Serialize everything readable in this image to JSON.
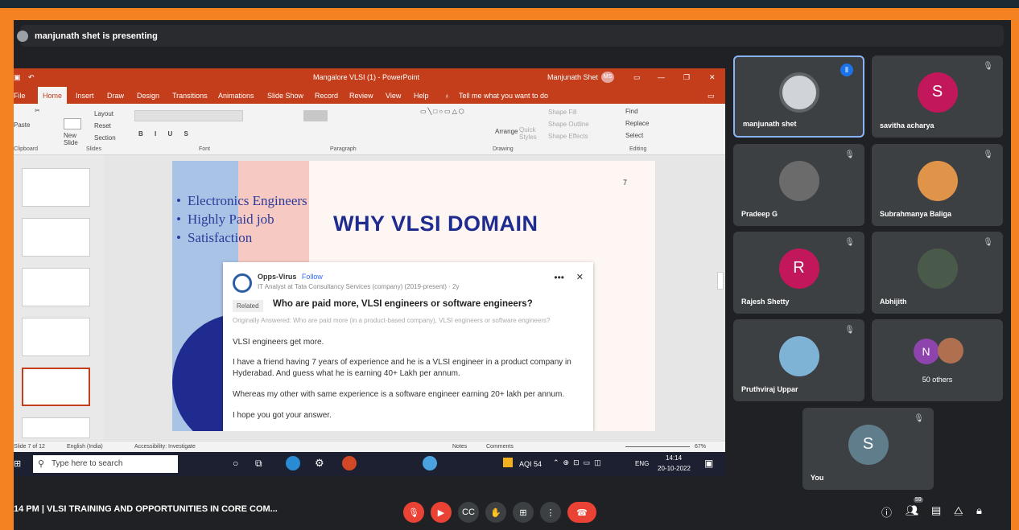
{
  "presenter": "manjunath shet is presenting",
  "ppt": {
    "title": "Mangalore VLSI (1) - PowerPoint",
    "user": "Manjunath Shet",
    "user_initials": "MS",
    "tabs": [
      "File",
      "Home",
      "Insert",
      "Draw",
      "Design",
      "Transitions",
      "Animations",
      "Slide Show",
      "Record",
      "Review",
      "View",
      "Help"
    ],
    "tell_me": "Tell me what you want to do",
    "ribbon": {
      "layout": "Layout",
      "reset": "Reset",
      "section": "Section",
      "new_slide": "New Slide",
      "arrange": "Arrange",
      "quick_styles": "Quick Styles",
      "shape_fill": "Shape Fill",
      "shape_outline": "Shape Outline",
      "shape_effects": "Shape Effects",
      "find": "Find",
      "replace": "Replace",
      "select": "Select",
      "groups": [
        "Clipboard",
        "Slides",
        "Font",
        "Paragraph",
        "Drawing",
        "Editing"
      ],
      "paste": "Paste"
    },
    "slide": {
      "bullets": [
        "Electronics Engineers",
        "Highly Paid job",
        "Satisfaction"
      ],
      "title": "WHY VLSI DOMAIN",
      "number": "7"
    },
    "quora": {
      "user": "Opps-Virus",
      "follow": "Follow",
      "sub": "IT Analyst at Tata Consultancy Services (company) (2019-present) · 2y",
      "related": "Related",
      "question": "Who are paid more, VLSI engineers or software engineers?",
      "orig": "Originally Answered: Who are paid more (in a product-based company), VLSI engineers or software engineers?",
      "p1": "VLSI engineers get more.",
      "p2": "I have a friend having 7 years of experience and he is a VLSI engineer in a product company in Hyderabad. And guess what he is earning 40+ Lakh per annum.",
      "p3": "Whereas my other with same experience is a software engineer earning 20+ lakh per annum.",
      "p4": "I hope you got your answer."
    },
    "status": {
      "slide": "Slide 7 of 12",
      "lang": "English (India)",
      "access": "Accessibility: Investigate",
      "notes": "Notes",
      "comments": "Comments",
      "zoom": "67%"
    },
    "taskbar": {
      "search": "Type here to search",
      "aqi": "AQI 54",
      "lang": "ENG",
      "time": "14:14",
      "date": "20-10-2022"
    }
  },
  "participants": [
    {
      "name": "manjunath shet",
      "initial": "",
      "color": "#d0d4d8"
    },
    {
      "name": "savitha acharya",
      "initial": "S",
      "color": "#c2185b"
    },
    {
      "name": "Pradeep G",
      "initial": "",
      "color": "#6b6b6b"
    },
    {
      "name": "Subrahmanya Baliga",
      "initial": "",
      "color": "#e0944a"
    },
    {
      "name": "Rajesh Shetty",
      "initial": "R",
      "color": "#c2185b"
    },
    {
      "name": "Abhijith",
      "initial": "",
      "color": "#4a5a4a"
    },
    {
      "name": "Pruthviraj Uppar",
      "initial": "",
      "color": "#7fb3d5"
    },
    {
      "name": "50 others",
      "initial": "N",
      "color": "#8e44ad"
    },
    {
      "name": "You",
      "initial": "S",
      "color": "#607d8b"
    }
  ],
  "meeting": {
    "time": "14 PM",
    "title": "VLSI TRAINING AND OPPORTUNITIES IN CORE COM...",
    "badge": "59"
  }
}
